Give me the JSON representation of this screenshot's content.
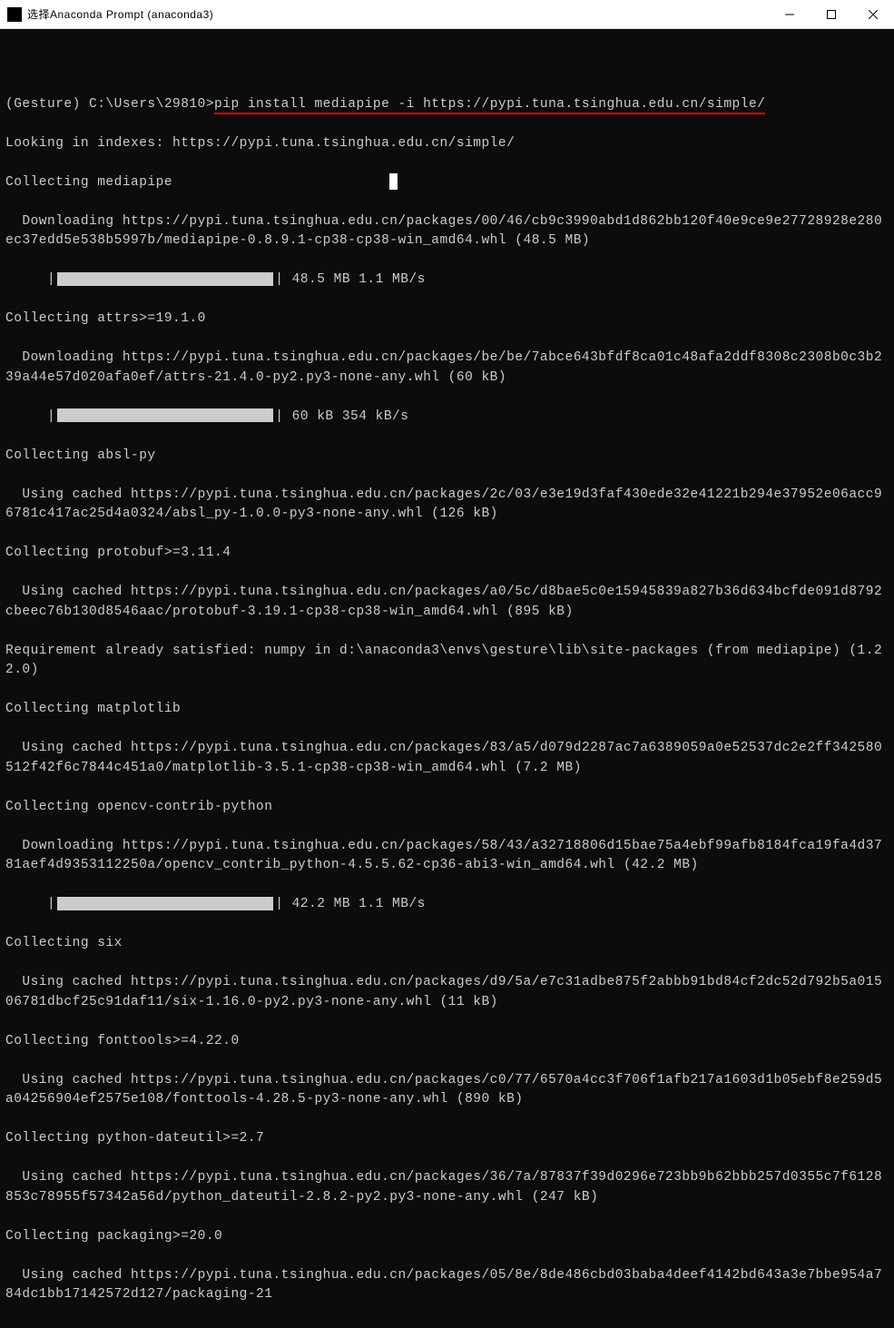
{
  "titlebar": {
    "title": "选择Anaconda Prompt (anaconda3)"
  },
  "terminal": {
    "prompt_env": "(Gesture) ",
    "prompt_path": "C:\\Users\\29810>",
    "command": "pip install mediapipe -i https://pypi.tuna.tsinghua.edu.cn/simple/",
    "lines": {
      "l1": "Looking in indexes: https://pypi.tuna.tsinghua.edu.cn/simple/",
      "l2": "Collecting mediapipe",
      "l3": "  Downloading https://pypi.tuna.tsinghua.edu.cn/packages/00/46/cb9c3990abd1d862bb120f40e9ce9e27728928e280ec37edd5e538b5997b/mediapipe-0.8.9.1-cp38-cp38-win_amd64.whl (48.5 MB)",
      "prog1_pre": "     |",
      "prog1_post": "| 48.5 MB 1.1 MB/s",
      "l4": "Collecting attrs>=19.1.0",
      "l5": "  Downloading https://pypi.tuna.tsinghua.edu.cn/packages/be/be/7abce643bfdf8ca01c48afa2ddf8308c2308b0c3b239a44e57d020afa0ef/attrs-21.4.0-py2.py3-none-any.whl (60 kB)",
      "prog2_pre": "     |",
      "prog2_post": "| 60 kB 354 kB/s",
      "l6": "Collecting absl-py",
      "l7": "  Using cached https://pypi.tuna.tsinghua.edu.cn/packages/2c/03/e3e19d3faf430ede32e41221b294e37952e06acc96781c417ac25d4a0324/absl_py-1.0.0-py3-none-any.whl (126 kB)",
      "l8": "Collecting protobuf>=3.11.4",
      "l9": "  Using cached https://pypi.tuna.tsinghua.edu.cn/packages/a0/5c/d8bae5c0e15945839a827b36d634bcfde091d8792cbeec76b130d8546aac/protobuf-3.19.1-cp38-cp38-win_amd64.whl (895 kB)",
      "l10": "Requirement already satisfied: numpy in d:\\anaconda3\\envs\\gesture\\lib\\site-packages (from mediapipe) (1.22.0)",
      "l11": "Collecting matplotlib",
      "l12": "  Using cached https://pypi.tuna.tsinghua.edu.cn/packages/83/a5/d079d2287ac7a6389059a0e52537dc2e2ff342580512f42f6c7844c451a0/matplotlib-3.5.1-cp38-cp38-win_amd64.whl (7.2 MB)",
      "l13": "Collecting opencv-contrib-python",
      "l14": "  Downloading https://pypi.tuna.tsinghua.edu.cn/packages/58/43/a32718806d15bae75a4ebf99afb8184fca19fa4d3781aef4d9353112250a/opencv_contrib_python-4.5.5.62-cp36-abi3-win_amd64.whl (42.2 MB)",
      "prog3_pre": "     |",
      "prog3_post": "| 42.2 MB 1.1 MB/s",
      "l15": "Collecting six",
      "l16": "  Using cached https://pypi.tuna.tsinghua.edu.cn/packages/d9/5a/e7c31adbe875f2abbb91bd84cf2dc52d792b5a01506781dbcf25c91daf11/six-1.16.0-py2.py3-none-any.whl (11 kB)",
      "l17": "Collecting fonttools>=4.22.0",
      "l18": "  Using cached https://pypi.tuna.tsinghua.edu.cn/packages/c0/77/6570a4cc3f706f1afb217a1603d1b05ebf8e259d5a04256904ef2575e108/fonttools-4.28.5-py3-none-any.whl (890 kB)",
      "l19": "Collecting python-dateutil>=2.7",
      "l20": "  Using cached https://pypi.tuna.tsinghua.edu.cn/packages/36/7a/87837f39d0296e723bb9b62bbb257d0355c7f6128853c78955f57342a56d/python_dateutil-2.8.2-py2.py3-none-any.whl (247 kB)",
      "l21": "Collecting packaging>=20.0",
      "l22": "  Using cached https://pypi.tuna.tsinghua.edu.cn/packages/05/8e/8de486cbd03baba4deef4142bd643a3e7bbe954a784dc1bb17142572d127/packaging-21"
    }
  }
}
